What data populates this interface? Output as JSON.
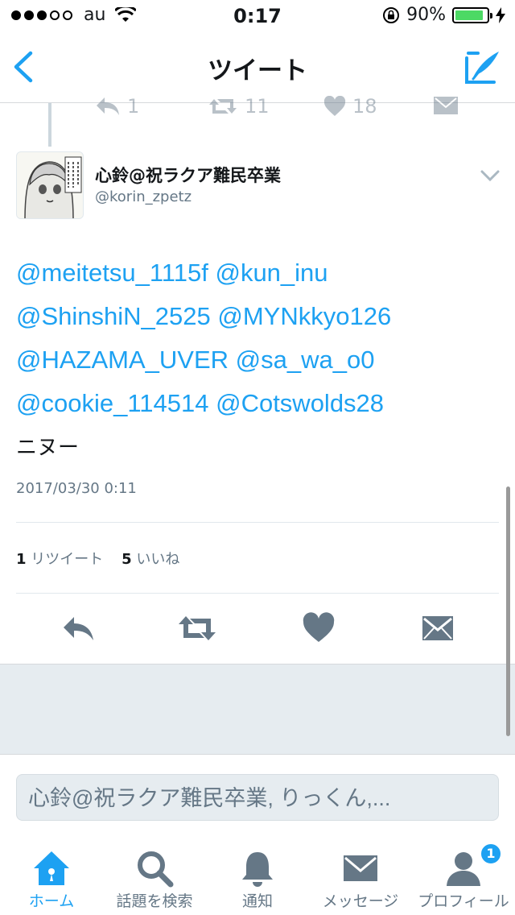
{
  "status_bar": {
    "carrier": "au",
    "time": "0:17",
    "battery_percent": "90%",
    "battery_level": 0.9,
    "signal_bars": 3
  },
  "nav": {
    "title": "ツイート",
    "back_icon": "chevron-left-icon",
    "compose_icon": "compose-tweet-icon"
  },
  "previous_tweet_actions": {
    "reply_count": "1",
    "retweet_count": "11",
    "like_count": "18"
  },
  "tweet": {
    "user_name": "心鈴@祝ラクア難民卒業",
    "handle": "@korin_zpetz",
    "mentions_line1": [
      "@meitetsu_1115f",
      "@kun_inu"
    ],
    "mentions_line2": [
      "@ShinshiN_2525",
      "@MYNkkyo126"
    ],
    "mentions_line3": [
      "@HAZAMA_UVER",
      "@sa_wa_o0"
    ],
    "mentions_line4": [
      "@cookie_114514",
      "@Cotswolds28"
    ],
    "body_text": "ニヌー",
    "timestamp": "2017/03/30 0:11",
    "retweet_count": "1",
    "retweet_label": "リツイート",
    "like_count": "5",
    "like_label": "いいね"
  },
  "reply": {
    "placeholder": "心鈴@祝ラクア難民卒業, りっくん,..."
  },
  "tabs": [
    {
      "label": "ホーム",
      "icon": "home-icon",
      "active": true
    },
    {
      "label": "話題を検索",
      "icon": "search-icon",
      "active": false
    },
    {
      "label": "通知",
      "icon": "bell-icon",
      "active": false
    },
    {
      "label": "メッセージ",
      "icon": "envelope-icon",
      "active": false
    },
    {
      "label": "プロフィール",
      "icon": "profile-icon",
      "active": false,
      "badge": "1"
    }
  ],
  "colors": {
    "accent": "#1da1f2",
    "muted": "#657786",
    "icon_gray": "#657786",
    "background_gray": "#e6ecf0"
  }
}
